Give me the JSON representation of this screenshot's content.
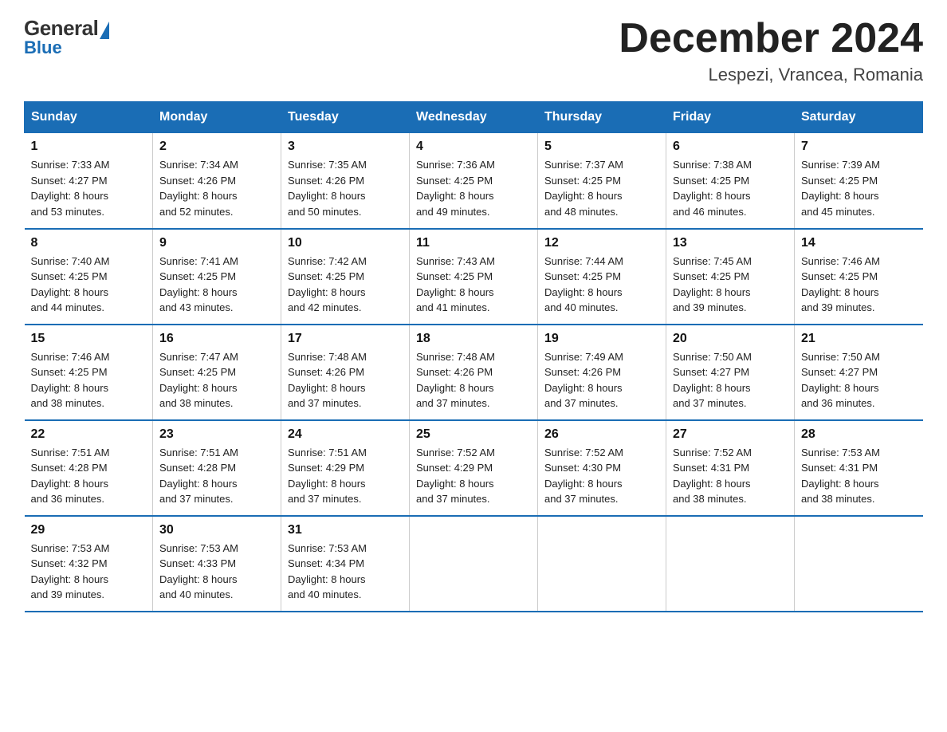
{
  "logo": {
    "general": "General",
    "blue": "Blue"
  },
  "header": {
    "month": "December 2024",
    "location": "Lespezi, Vrancea, Romania"
  },
  "weekdays": [
    "Sunday",
    "Monday",
    "Tuesday",
    "Wednesday",
    "Thursday",
    "Friday",
    "Saturday"
  ],
  "weeks": [
    [
      {
        "day": "1",
        "sunrise": "7:33 AM",
        "sunset": "4:27 PM",
        "daylight": "8 hours and 53 minutes."
      },
      {
        "day": "2",
        "sunrise": "7:34 AM",
        "sunset": "4:26 PM",
        "daylight": "8 hours and 52 minutes."
      },
      {
        "day": "3",
        "sunrise": "7:35 AM",
        "sunset": "4:26 PM",
        "daylight": "8 hours and 50 minutes."
      },
      {
        "day": "4",
        "sunrise": "7:36 AM",
        "sunset": "4:25 PM",
        "daylight": "8 hours and 49 minutes."
      },
      {
        "day": "5",
        "sunrise": "7:37 AM",
        "sunset": "4:25 PM",
        "daylight": "8 hours and 48 minutes."
      },
      {
        "day": "6",
        "sunrise": "7:38 AM",
        "sunset": "4:25 PM",
        "daylight": "8 hours and 46 minutes."
      },
      {
        "day": "7",
        "sunrise": "7:39 AM",
        "sunset": "4:25 PM",
        "daylight": "8 hours and 45 minutes."
      }
    ],
    [
      {
        "day": "8",
        "sunrise": "7:40 AM",
        "sunset": "4:25 PM",
        "daylight": "8 hours and 44 minutes."
      },
      {
        "day": "9",
        "sunrise": "7:41 AM",
        "sunset": "4:25 PM",
        "daylight": "8 hours and 43 minutes."
      },
      {
        "day": "10",
        "sunrise": "7:42 AM",
        "sunset": "4:25 PM",
        "daylight": "8 hours and 42 minutes."
      },
      {
        "day": "11",
        "sunrise": "7:43 AM",
        "sunset": "4:25 PM",
        "daylight": "8 hours and 41 minutes."
      },
      {
        "day": "12",
        "sunrise": "7:44 AM",
        "sunset": "4:25 PM",
        "daylight": "8 hours and 40 minutes."
      },
      {
        "day": "13",
        "sunrise": "7:45 AM",
        "sunset": "4:25 PM",
        "daylight": "8 hours and 39 minutes."
      },
      {
        "day": "14",
        "sunrise": "7:46 AM",
        "sunset": "4:25 PM",
        "daylight": "8 hours and 39 minutes."
      }
    ],
    [
      {
        "day": "15",
        "sunrise": "7:46 AM",
        "sunset": "4:25 PM",
        "daylight": "8 hours and 38 minutes."
      },
      {
        "day": "16",
        "sunrise": "7:47 AM",
        "sunset": "4:25 PM",
        "daylight": "8 hours and 38 minutes."
      },
      {
        "day": "17",
        "sunrise": "7:48 AM",
        "sunset": "4:26 PM",
        "daylight": "8 hours and 37 minutes."
      },
      {
        "day": "18",
        "sunrise": "7:48 AM",
        "sunset": "4:26 PM",
        "daylight": "8 hours and 37 minutes."
      },
      {
        "day": "19",
        "sunrise": "7:49 AM",
        "sunset": "4:26 PM",
        "daylight": "8 hours and 37 minutes."
      },
      {
        "day": "20",
        "sunrise": "7:50 AM",
        "sunset": "4:27 PM",
        "daylight": "8 hours and 37 minutes."
      },
      {
        "day": "21",
        "sunrise": "7:50 AM",
        "sunset": "4:27 PM",
        "daylight": "8 hours and 36 minutes."
      }
    ],
    [
      {
        "day": "22",
        "sunrise": "7:51 AM",
        "sunset": "4:28 PM",
        "daylight": "8 hours and 36 minutes."
      },
      {
        "day": "23",
        "sunrise": "7:51 AM",
        "sunset": "4:28 PM",
        "daylight": "8 hours and 37 minutes."
      },
      {
        "day": "24",
        "sunrise": "7:51 AM",
        "sunset": "4:29 PM",
        "daylight": "8 hours and 37 minutes."
      },
      {
        "day": "25",
        "sunrise": "7:52 AM",
        "sunset": "4:29 PM",
        "daylight": "8 hours and 37 minutes."
      },
      {
        "day": "26",
        "sunrise": "7:52 AM",
        "sunset": "4:30 PM",
        "daylight": "8 hours and 37 minutes."
      },
      {
        "day": "27",
        "sunrise": "7:52 AM",
        "sunset": "4:31 PM",
        "daylight": "8 hours and 38 minutes."
      },
      {
        "day": "28",
        "sunrise": "7:53 AM",
        "sunset": "4:31 PM",
        "daylight": "8 hours and 38 minutes."
      }
    ],
    [
      {
        "day": "29",
        "sunrise": "7:53 AM",
        "sunset": "4:32 PM",
        "daylight": "8 hours and 39 minutes."
      },
      {
        "day": "30",
        "sunrise": "7:53 AM",
        "sunset": "4:33 PM",
        "daylight": "8 hours and 40 minutes."
      },
      {
        "day": "31",
        "sunrise": "7:53 AM",
        "sunset": "4:34 PM",
        "daylight": "8 hours and 40 minutes."
      },
      null,
      null,
      null,
      null
    ]
  ],
  "labels": {
    "sunrise": "Sunrise:",
    "sunset": "Sunset:",
    "daylight": "Daylight:"
  }
}
